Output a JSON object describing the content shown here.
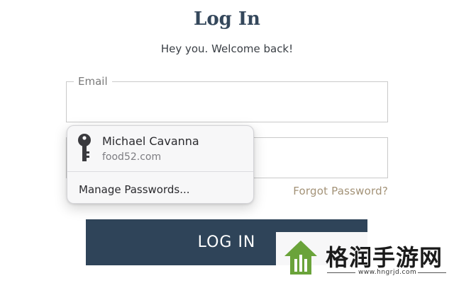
{
  "page": {
    "title": "Log In",
    "subtitle": "Hey you. Welcome back!"
  },
  "form": {
    "email_label": "Email",
    "email_value": "",
    "password_value": "",
    "forgot_link": "Forgot Password?",
    "login_button": "LOG IN"
  },
  "autofill": {
    "entry_name": "Michael Cavanna",
    "entry_site": "food52.com",
    "manage_label": "Manage Passwords..."
  },
  "watermark": {
    "text": "格润手游网",
    "url": "www.hngrjd.com"
  },
  "colors": {
    "button_bg": "#2f4459",
    "title": "#34475b",
    "forgot_link": "#a39277",
    "watermark_green": "#6aa33a"
  }
}
